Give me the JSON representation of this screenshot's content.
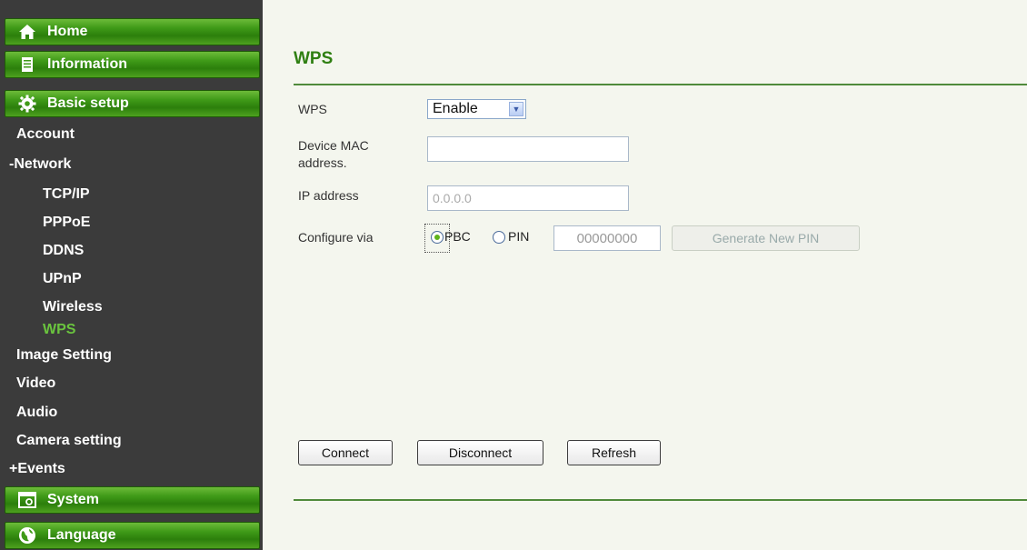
{
  "sidebar": {
    "main": {
      "home": "Home",
      "information": "Information",
      "basic_setup": "Basic setup",
      "system": "System",
      "language": "Language"
    },
    "items": {
      "account": "Account",
      "network": "-Network",
      "tcpip": "TCP/IP",
      "pppoe": "PPPoE",
      "ddns": "DDNS",
      "upnp": "UPnP",
      "wireless": "Wireless",
      "wps": "WPS",
      "image_setting": "Image Setting",
      "video": "Video",
      "audio": "Audio",
      "camera_setting": "Camera setting",
      "events": "+Events"
    }
  },
  "page": {
    "title": "WPS",
    "wps_label": "WPS",
    "wps_value": "Enable",
    "mac_label_line1": "Device MAC",
    "mac_label_line2": "address.",
    "mac_value": "",
    "ip_label": "IP address",
    "ip_value": "0.0.0.0",
    "configure_label": "Configure via",
    "pbc_label": "PBC",
    "pin_label": "PIN",
    "pin_value": "00000000",
    "generate_pin": "Generate New PIN",
    "connect": "Connect",
    "disconnect": "Disconnect",
    "refresh": "Refresh"
  },
  "colors": {
    "accent": "#2f7f12",
    "active_nav": "#6ac43e",
    "sidebar_bg": "#3b3b3b"
  }
}
